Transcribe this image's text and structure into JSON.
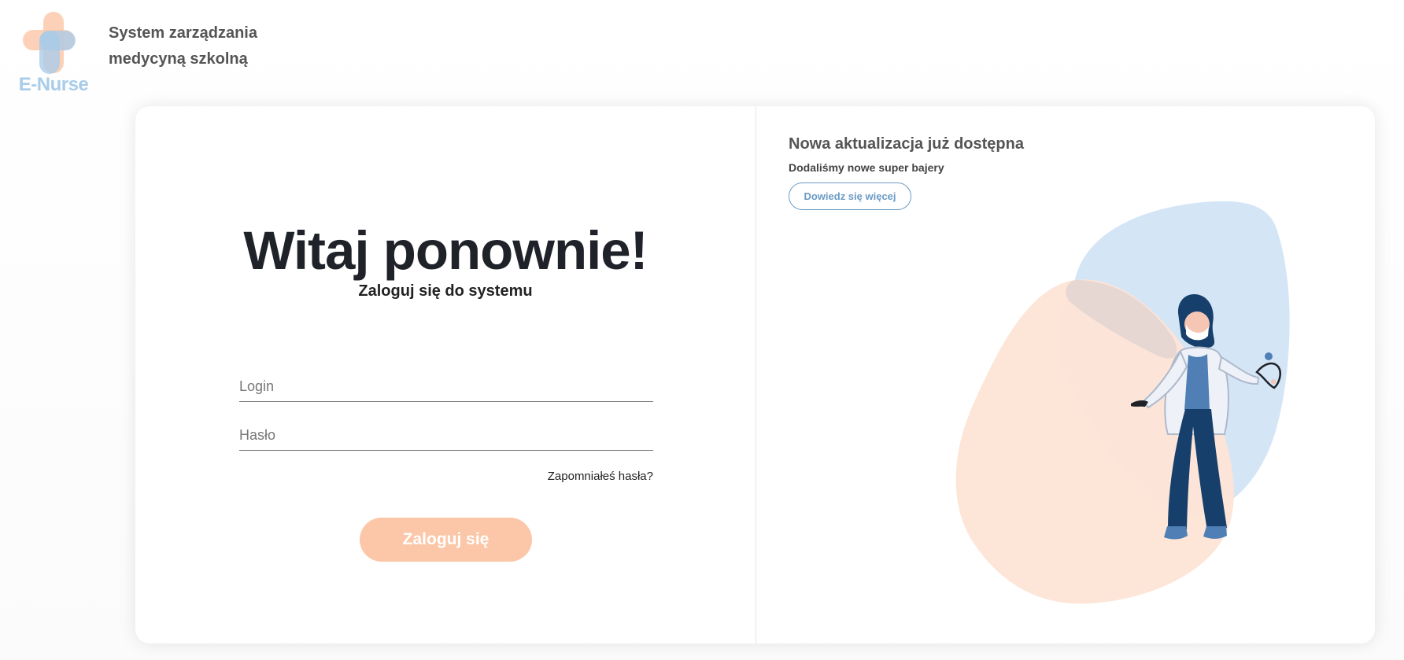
{
  "brand": {
    "logo_text": "E-Nurse",
    "system_title": "System zarządzania medycyną szkolną"
  },
  "login": {
    "heading": "Witaj ponownie!",
    "subheading": "Zaloguj się do systemu",
    "login_placeholder": "Login",
    "password_placeholder": "Hasło",
    "login_value": "",
    "password_value": "",
    "forgot_password": "Zapomniałeś hasła?",
    "submit_label": "Zaloguj się"
  },
  "update": {
    "title": "Nowa aktualizacja już dostępna",
    "subtitle": "Dodaliśmy nowe super bajery",
    "button_label": "Dowiedz się więcej"
  },
  "colors": {
    "accent_peach": "#fcc7a8",
    "accent_blue": "#a8cce9",
    "link_blue": "#6b9bc4"
  },
  "icons": {
    "logo": "medical-cross-icon",
    "illustration": "doctor-with-stethoscope"
  }
}
